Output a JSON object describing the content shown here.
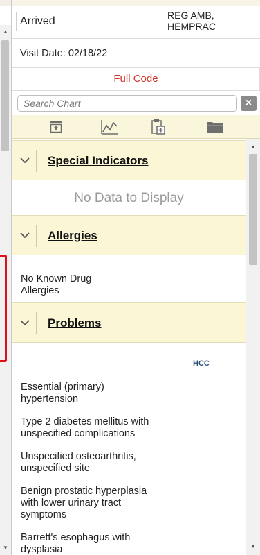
{
  "header": {
    "status": "Arrived",
    "department_line1": "REG AMB,",
    "department_line2": "HEMPRAC",
    "visit_date": "Visit Date: 02/18/22",
    "code_status": "Full Code"
  },
  "search": {
    "placeholder": "Search Chart",
    "clear_label": "×"
  },
  "toolbar": {
    "icons": [
      "upload-tray-icon",
      "chart-line-icon",
      "clipboard-add-icon",
      "folder-icon"
    ]
  },
  "sections": {
    "special_indicators": {
      "title": "Special Indicators",
      "empty_text": "No Data to Display"
    },
    "allergies": {
      "title": "Allergies",
      "line1": "No Known Drug",
      "line2": "Allergies"
    },
    "problems": {
      "title": "Problems",
      "hcc_label": "HCC",
      "items": [
        {
          "line1": "Essential (primary)",
          "line2": "hypertension"
        },
        {
          "line1": "Type 2 diabetes mellitus with",
          "line2": "unspecified complications"
        },
        {
          "line1": "Unspecified osteoarthritis,",
          "line2": "unspecified site"
        },
        {
          "line1": "Benign prostatic hyperplasia",
          "line2": "with lower urinary tract",
          "line3": "symptoms"
        },
        {
          "line1": "Barrett's esophagus with",
          "line2": "dysplasia"
        }
      ]
    }
  },
  "colors": {
    "accent_red": "#d0342c",
    "section_bg": "#fbf7d6",
    "highlight_outline": "#e0101a"
  }
}
